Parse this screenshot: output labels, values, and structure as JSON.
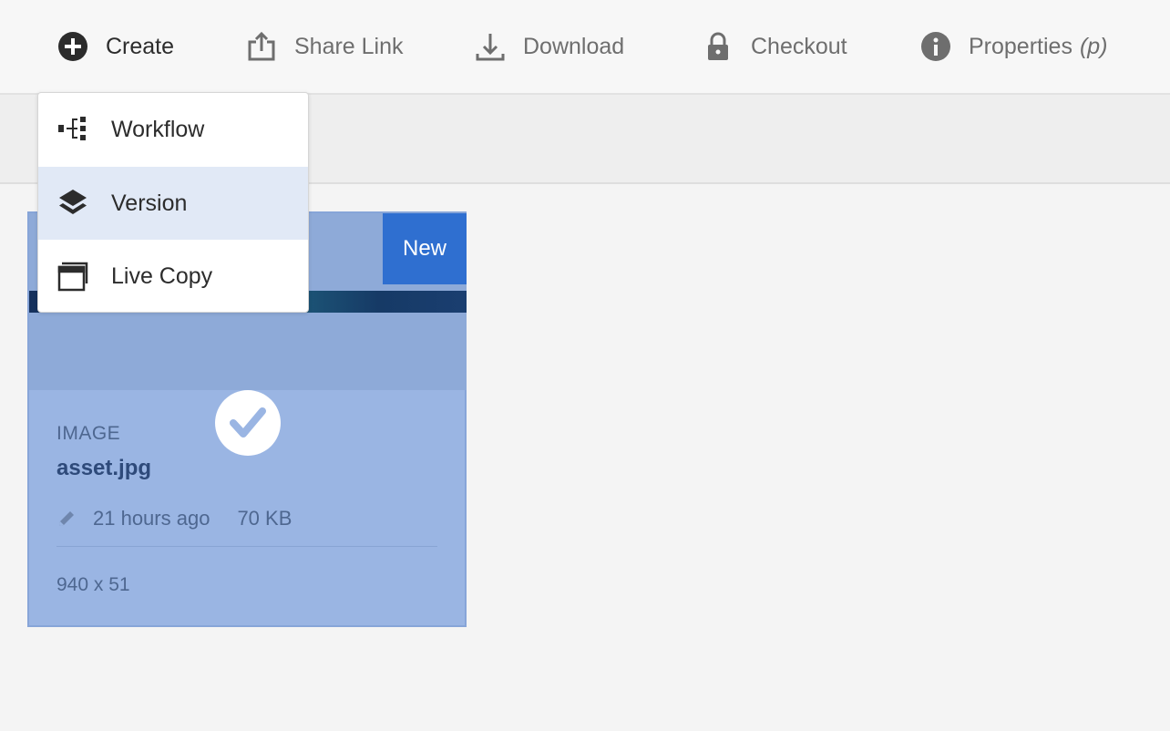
{
  "actionbar": {
    "create": {
      "label": "Create",
      "icon": "plus-circle-icon"
    },
    "share_link": {
      "label": "Share Link",
      "icon": "share-upload-icon"
    },
    "download": {
      "label": "Download",
      "icon": "download-icon"
    },
    "checkout": {
      "label": "Checkout",
      "icon": "lock-icon"
    },
    "properties": {
      "label": "Properties",
      "shortcut": "(p)",
      "icon": "info-icon"
    }
  },
  "create_menu": {
    "items": [
      {
        "label": "Workflow",
        "icon": "workflow-icon",
        "selected": false
      },
      {
        "label": "Version",
        "icon": "layers-icon",
        "selected": true
      },
      {
        "label": "Live Copy",
        "icon": "live-copy-icon",
        "selected": false
      }
    ]
  },
  "card": {
    "badge": "New",
    "type": "IMAGE",
    "name": "asset.jpg",
    "modified": "21 hours ago",
    "size": "70 KB",
    "dimensions": "940 x 51",
    "selected": true
  },
  "colors": {
    "selection_fill": "#9ab5e3",
    "badge_blue": "#2f6fd0",
    "menu_highlight": "#e1e9f6"
  }
}
